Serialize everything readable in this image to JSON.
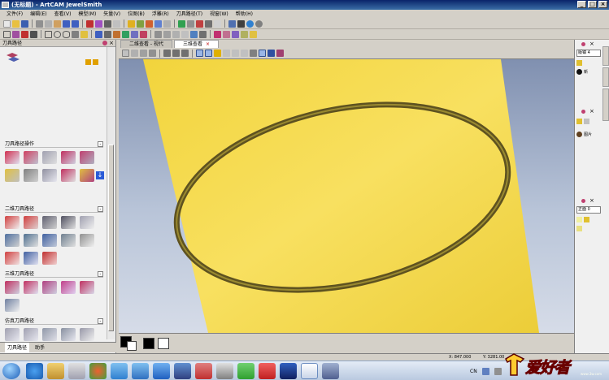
{
  "window": {
    "title": "(无标题) - ArtCAM JewelSmith"
  },
  "menu": [
    "文件(F)",
    "编辑(E)",
    "查看(V)",
    "模型(M)",
    "矢量(V)",
    "位图(B)",
    "浮雕(R)",
    "刀具路径(T)",
    "视窗(W)",
    "帮助(H)"
  ],
  "left_panel": {
    "title": "刀具路径",
    "sections": [
      {
        "title": "刀具路径操作"
      },
      {
        "title": "二维刀具路径"
      },
      {
        "title": "三维刀具路径"
      },
      {
        "title": "仿真刀具路径"
      }
    ],
    "bottom_tabs": [
      "刀具路径",
      "助手"
    ]
  },
  "view_tabs": [
    {
      "label": "二维查看 - 视代"
    },
    {
      "label": "三维查看"
    }
  ],
  "right_panel": {
    "top_select": "版镇 4",
    "item_top": "新",
    "item_mid": "图片",
    "bottom_select": "正面 0"
  },
  "status": {
    "x": "X: 847.000",
    "y": "Y: 3281.00"
  },
  "tray": {
    "lang": "CN"
  },
  "brand": {
    "text": "爱好者",
    "sub": "www.3w.com"
  },
  "colors": {
    "title_bar": "#0a246a",
    "relief_face": "#f5d84a",
    "groove": "#7a6a20",
    "view_bg_top": "#8090b0",
    "view_bg_bottom": "#d6dce8"
  }
}
